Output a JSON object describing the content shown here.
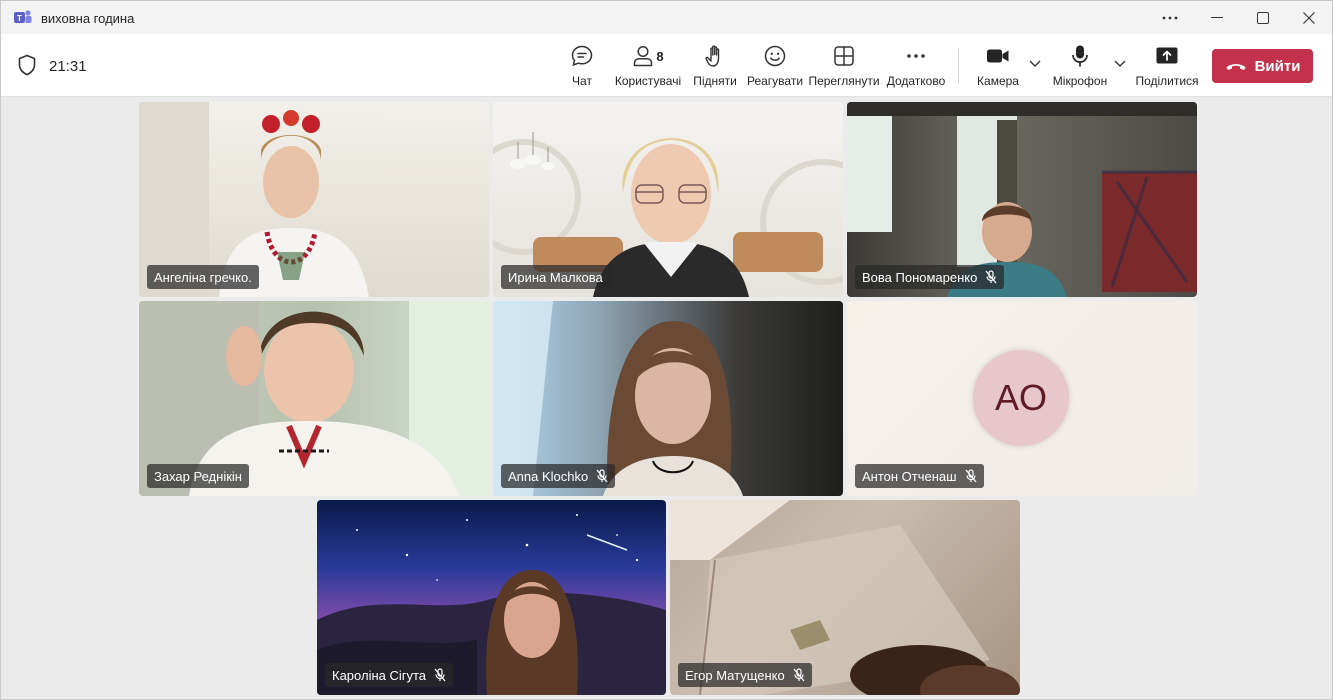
{
  "window": {
    "title": "виховна година",
    "controls": [
      "more-icon",
      "minimize-icon",
      "maximize-icon",
      "close-icon"
    ]
  },
  "toolbar": {
    "timer": "21:31",
    "chat_label": "Чат",
    "participants_label": "Користувачі",
    "participants_count": "8",
    "raise_label": "Підняти",
    "react_label": "Реагувати",
    "view_label": "Переглянути",
    "more_label": "Додатково",
    "camera_label": "Камера",
    "mic_label": "Мікрофон",
    "share_label": "Поділитися",
    "leave_label": "Вийти"
  },
  "colors": {
    "leave": "#c4314b",
    "avatar_bg": "#e8c7cc",
    "avatar_text": "#5e1b26",
    "brand": "#5b5fc7"
  },
  "participants": [
    {
      "name": "Ангеліна гречко.",
      "muted": false
    },
    {
      "name": "Ирина Малкова",
      "muted": false
    },
    {
      "name": "Вова Пономаренко",
      "muted": true
    },
    {
      "name": "Захар Реднікін",
      "muted": false
    },
    {
      "name": "Anna Klochko",
      "muted": true
    },
    {
      "name": "Антон Отченаш",
      "muted": true,
      "initials": "AO"
    },
    {
      "name": "Кароліна Сігута",
      "muted": true
    },
    {
      "name": "Егор Матущенко",
      "muted": true
    }
  ]
}
